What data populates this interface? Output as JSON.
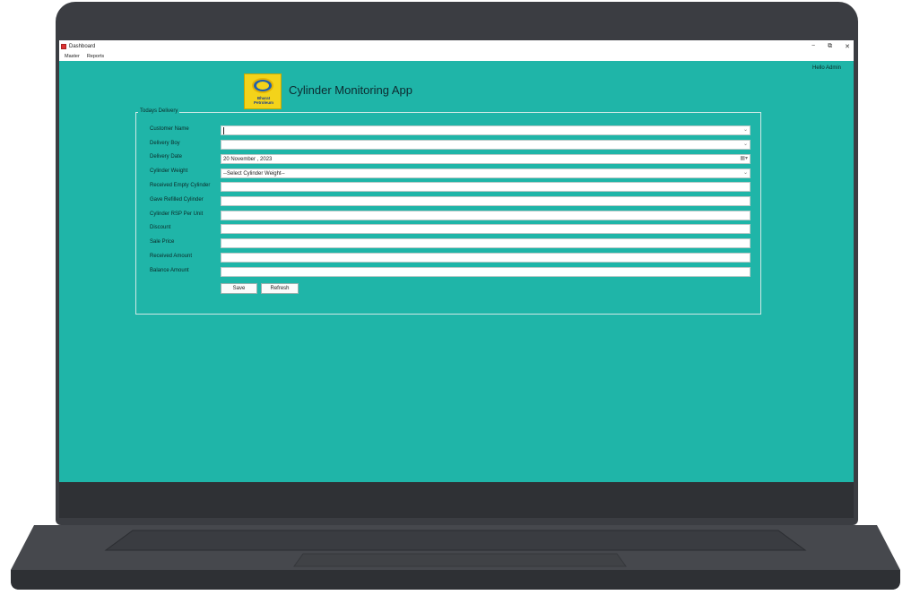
{
  "window": {
    "title": "Dashboard",
    "minimize": "−",
    "restore": "⧉",
    "close": "✕"
  },
  "menu": {
    "items": [
      "Master",
      "Reports"
    ]
  },
  "greeting": "Hello Admin",
  "logo": {
    "line1": "Bharat",
    "line2": "Petroleum"
  },
  "app_title": "Cylinder Monitoring App",
  "group_title": "Todays Delivery",
  "form": {
    "customer_name_label": "Customer Name",
    "delivery_boy_label": "Delivery Boy",
    "delivery_date_label": "Delivery Date",
    "delivery_date_value": "20 November , 2023",
    "cylinder_weight_label": "Cylinder Weight",
    "cylinder_weight_value": "--Select Cylinder Weight--",
    "received_empty_label": "Received Empty Cylinder",
    "gave_refilled_label": "Gave Refilled Cylinder",
    "rsp_label": "Cylinder RSP Per Unit",
    "discount_label": "Discount",
    "sale_price_label": "Sale Price",
    "received_amount_label": "Received Amount",
    "balance_amount_label": "Balance Amount"
  },
  "buttons": {
    "save": "Save",
    "refresh": "Refresh"
  },
  "colors": {
    "screen": "#1fb5a8",
    "laptop": "#3b3d42"
  }
}
